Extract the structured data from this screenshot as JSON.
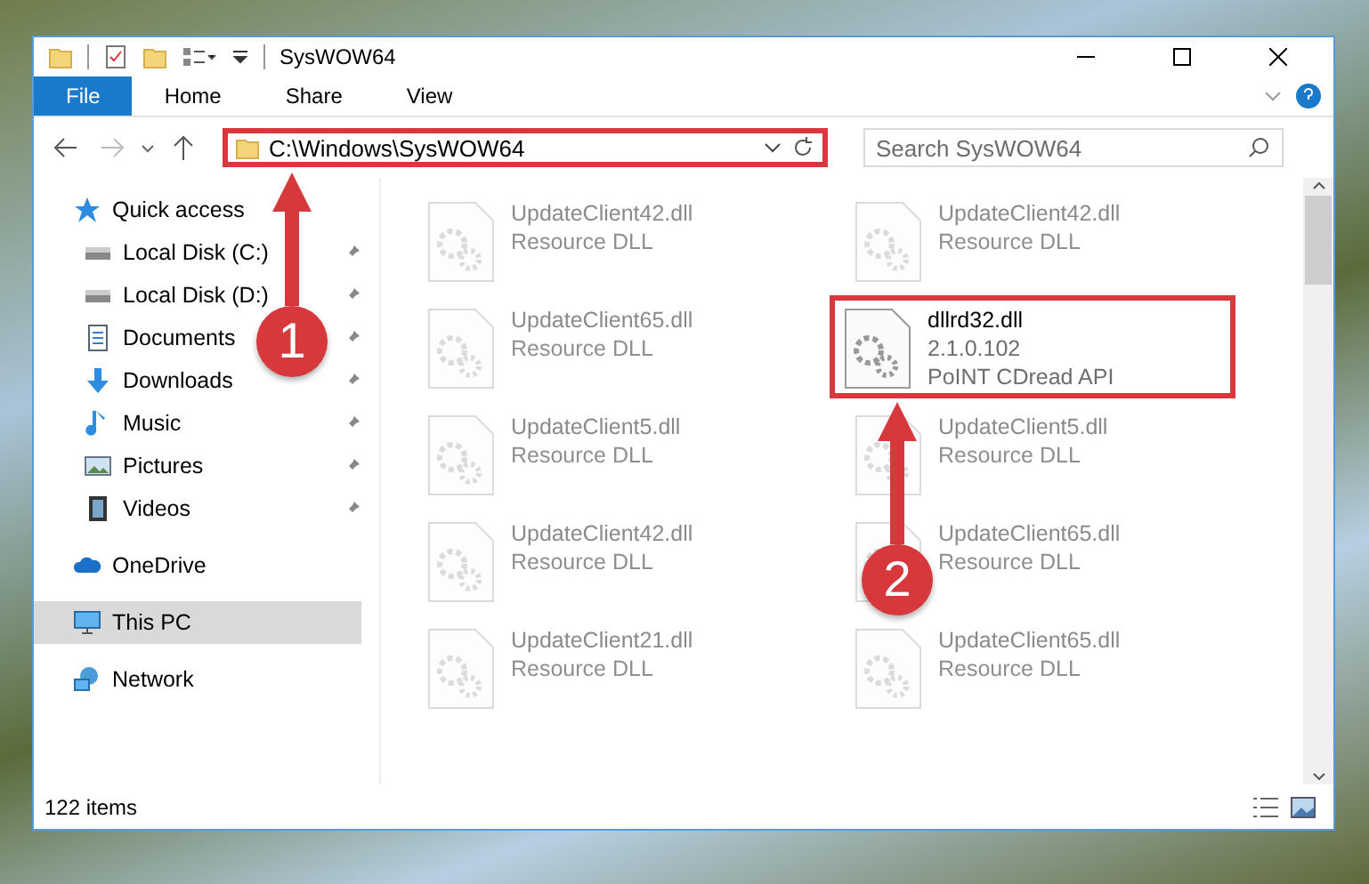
{
  "window": {
    "title": "SysWOW64"
  },
  "ribbon_tabs": [
    {
      "label": "File",
      "selected": true
    },
    {
      "label": "Home",
      "selected": false
    },
    {
      "label": "Share",
      "selected": false
    },
    {
      "label": "View",
      "selected": false
    }
  ],
  "address_bar": {
    "path": "C:\\Windows\\SysWOW64",
    "highlighted": true
  },
  "search": {
    "placeholder": "Search SysWOW64"
  },
  "sidebar": {
    "items": [
      {
        "label": "Quick access",
        "kind": "star",
        "selected": false,
        "children": [
          {
            "label": "Local Disk (C:)",
            "kind": "drive",
            "pinned": true,
            "selected": false
          },
          {
            "label": "Local Disk (D:)",
            "kind": "drive",
            "pinned": true,
            "selected": false
          },
          {
            "label": "Documents",
            "kind": "document",
            "pinned": true,
            "selected": false
          },
          {
            "label": "Downloads",
            "kind": "download",
            "pinned": true,
            "selected": false
          },
          {
            "label": "Music",
            "kind": "music",
            "pinned": true,
            "selected": false
          },
          {
            "label": "Pictures",
            "kind": "picture",
            "pinned": true,
            "selected": false
          },
          {
            "label": "Videos",
            "kind": "video",
            "pinned": true,
            "selected": false
          }
        ]
      },
      {
        "label": "OneDrive",
        "kind": "cloud",
        "selected": false
      },
      {
        "label": "This PC",
        "kind": "monitor",
        "selected": true
      },
      {
        "label": "Network",
        "kind": "network",
        "selected": false
      }
    ]
  },
  "files": [
    {
      "name": "UpdateClient42.dll",
      "lines": [
        "Resource DLL"
      ],
      "faded": true,
      "highlighted": false
    },
    {
      "name": "UpdateClient42.dll",
      "lines": [
        "Resource DLL"
      ],
      "faded": true,
      "highlighted": false
    },
    {
      "name": "UpdateClient65.dll",
      "lines": [
        "Resource DLL"
      ],
      "faded": true,
      "highlighted": false
    },
    {
      "name": "dllrd32.dll",
      "lines": [
        "2.1.0.102",
        "PoINT CDread API"
      ],
      "faded": false,
      "highlighted": true
    },
    {
      "name": "UpdateClient5.dll",
      "lines": [
        "Resource DLL"
      ],
      "faded": true,
      "highlighted": false
    },
    {
      "name": "UpdateClient5.dll",
      "lines": [
        "Resource DLL"
      ],
      "faded": true,
      "highlighted": false
    },
    {
      "name": "UpdateClient42.dll",
      "lines": [
        "Resource DLL"
      ],
      "faded": true,
      "highlighted": false
    },
    {
      "name": "UpdateClient65.dll",
      "lines": [
        "Resource DLL"
      ],
      "faded": true,
      "highlighted": false
    },
    {
      "name": "UpdateClient21.dll",
      "lines": [
        "Resource DLL"
      ],
      "faded": true,
      "highlighted": false
    },
    {
      "name": "UpdateClient65.dll",
      "lines": [
        "Resource DLL"
      ],
      "faded": true,
      "highlighted": false
    }
  ],
  "status_bar": {
    "count": "122 items"
  },
  "annotations": [
    {
      "number": "1"
    },
    {
      "number": "2"
    }
  ]
}
